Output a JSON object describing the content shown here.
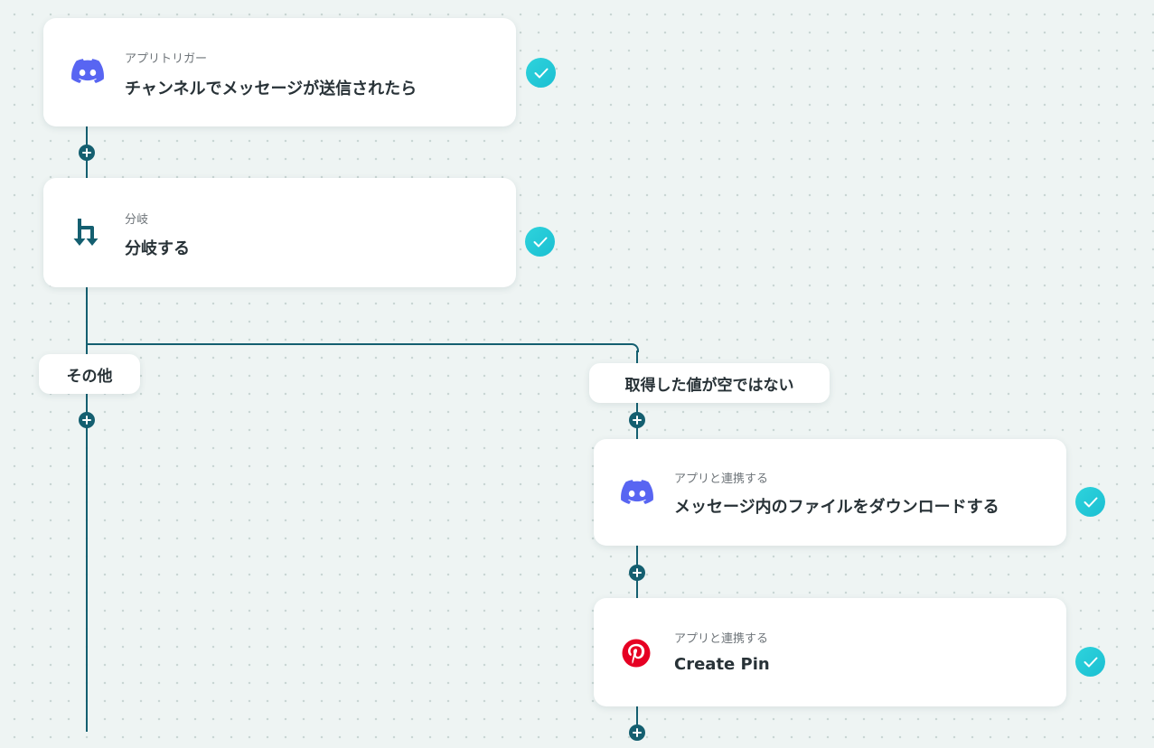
{
  "flow": {
    "trigger": {
      "subtitle": "アプリトリガー",
      "title": "チャンネルでメッセージが送信されたら",
      "icon": "discord-icon"
    },
    "branch": {
      "subtitle": "分岐",
      "title": "分岐する",
      "icon": "branch-icon"
    },
    "branch_labels": {
      "other": "その他",
      "not_empty": "取得した値が空ではない"
    },
    "download_step": {
      "subtitle": "アプリと連携する",
      "title": "メッセージ内のファイルをダウンロードする",
      "icon": "discord-icon"
    },
    "pin_step": {
      "subtitle": "アプリと連携する",
      "title": "Create Pin",
      "icon": "pinterest-icon"
    }
  },
  "colors": {
    "line": "#145f70",
    "check": "#22c9d8",
    "discord": "#5865f2",
    "pinterest": "#e60023",
    "background": "#eef4f3"
  }
}
